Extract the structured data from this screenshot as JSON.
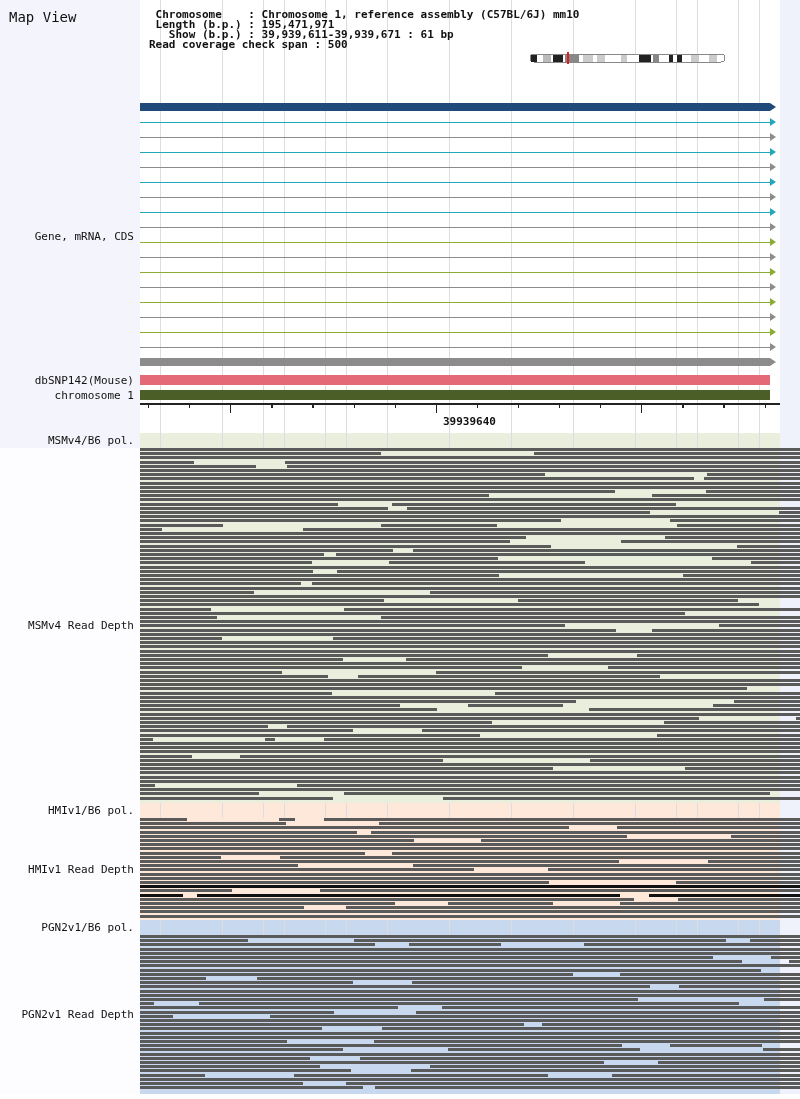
{
  "title": "Map View",
  "info_lines": [
    "Chromosome    : Chromosome 1, reference assembly (C57BL/6J) mm10",
    "Length (b.p.) : 195,471,971",
    "Show (b.p.) : 39,939,611-39,939,671 : 61 bp",
    "Read coverage check span : 500"
  ],
  "gene_track": {
    "label": "Gene, mRNA, CDS",
    "features": [
      {
        "kind": "bar",
        "color": "#1f4a7a"
      },
      {
        "kind": "line",
        "color": "#22a8b8"
      },
      {
        "kind": "line",
        "color": "#8c8c8c"
      },
      {
        "kind": "line",
        "color": "#22a8b8"
      },
      {
        "kind": "line",
        "color": "#8c8c8c"
      },
      {
        "kind": "line",
        "color": "#22a8b8"
      },
      {
        "kind": "line",
        "color": "#8c8c8c"
      },
      {
        "kind": "line",
        "color": "#22a8b8"
      },
      {
        "kind": "line",
        "color": "#8c8c8c"
      },
      {
        "kind": "line",
        "color": "#8aac30"
      },
      {
        "kind": "line",
        "color": "#8c8c8c"
      },
      {
        "kind": "line",
        "color": "#8aac30"
      },
      {
        "kind": "line",
        "color": "#8c8c8c"
      },
      {
        "kind": "line",
        "color": "#8aac30"
      },
      {
        "kind": "line",
        "color": "#8c8c8c"
      },
      {
        "kind": "line",
        "color": "#8aac30"
      },
      {
        "kind": "line",
        "color": "#8c8c8c"
      },
      {
        "kind": "bar",
        "color": "#8c8c8c"
      }
    ]
  },
  "feature_tracks": [
    {
      "label": "dbSNP142(Mouse)",
      "color": "#e46a78"
    },
    {
      "label": "chromosome 1",
      "color": "#4b5e28"
    }
  ],
  "ruler": {
    "label": "39939640"
  },
  "samples": [
    {
      "pol_label": "MSMv4/B6 pol.",
      "depth_label": "MSMv4 Read Depth",
      "color": "#eaeedc"
    },
    {
      "pol_label": "HMIv1/B6 pol.",
      "depth_label": "HMIv1 Read Depth",
      "color": "#fde8da"
    },
    {
      "pol_label": "PGN2v1/B6 pol.",
      "depth_label": "PGN2v1 Read Depth",
      "color": "#c8d8ee"
    }
  ]
}
